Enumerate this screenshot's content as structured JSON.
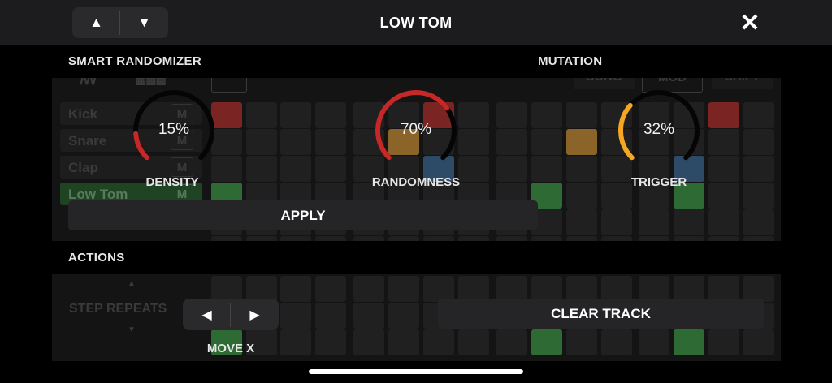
{
  "header": {
    "title": "LOW TOM",
    "prev_track_glyph": "▲",
    "next_track_glyph": "▼",
    "close_glyph": "✕"
  },
  "smart_randomizer": {
    "label": "SMART RANDOMIZER",
    "mutation_label": "MUTATION",
    "knobs": [
      {
        "id": "density",
        "label": "DENSITY",
        "value": 15,
        "display": "15%",
        "color": "#c62828"
      },
      {
        "id": "randomness",
        "label": "RANDOMNESS",
        "value": 70,
        "display": "70%",
        "color": "#c62828"
      },
      {
        "id": "trigger",
        "label": "TRIGGER",
        "value": 32,
        "display": "32%",
        "color": "#f5a623"
      }
    ],
    "apply_label": "APPLY"
  },
  "background": {
    "tracks": [
      {
        "name": "Kick",
        "mute": "M"
      },
      {
        "name": "Snare",
        "mute": "M"
      },
      {
        "name": "Clap",
        "mute": "M"
      },
      {
        "name": "Low Tom",
        "mute": "M"
      }
    ],
    "top_buttons": [
      "SONG",
      "MOD",
      "SHIFT"
    ],
    "step_repeats_label": "STEP REPEATS"
  },
  "actions": {
    "label": "ACTIONS",
    "move_left_glyph": "◀",
    "move_right_glyph": "▶",
    "move_label": "MOVE X",
    "clear_label": "CLEAR TRACK"
  },
  "colors": {
    "accent_red": "#c62828",
    "accent_orange": "#f5a623",
    "step_green": "#2e6b34",
    "step_red": "#7a2424",
    "step_orange": "#8a6428",
    "step_blue": "#2d4a66"
  }
}
